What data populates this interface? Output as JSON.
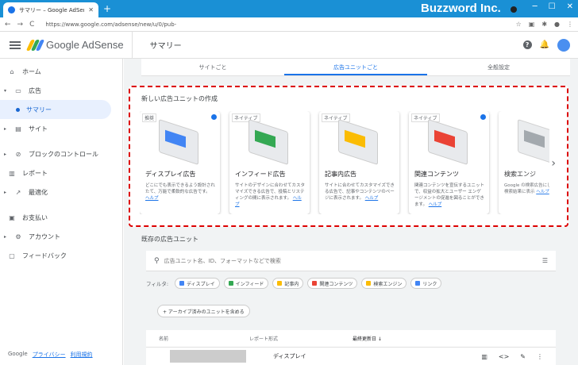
{
  "browser": {
    "tab_title": "サマリー – Google AdSense",
    "tab_close": "✕",
    "new_tab": "+",
    "url": "https://www.google.com/adsense/new/u/0/pub-",
    "nav_back": "←",
    "nav_forward": "→",
    "nav_reload": "C",
    "brand": "Buzzword Inc.",
    "win_min": "─",
    "win_max": "☐",
    "win_close": "✕"
  },
  "app": {
    "logo_text": "Google AdSense",
    "page_title": "サマリー",
    "help_icon": "?",
    "logo_colors": [
      "#fbbc04",
      "#34a853",
      "#4285f4"
    ]
  },
  "sidebar": {
    "items": [
      {
        "label": "ホーム",
        "icon": "home-icon",
        "glyph": "⌂"
      },
      {
        "label": "広告",
        "icon": "ads-icon",
        "glyph": "▭"
      },
      {
        "label": "サマリー",
        "icon": "dot"
      },
      {
        "label": "サイト",
        "icon": "sites-icon",
        "glyph": "▤"
      },
      {
        "label": "ブロックのコントロール",
        "icon": "block-icon",
        "glyph": "⊘"
      },
      {
        "label": "レポート",
        "icon": "report-icon",
        "glyph": "▥"
      },
      {
        "label": "最適化",
        "icon": "optimize-icon",
        "glyph": "↗"
      },
      {
        "label": "お支払い",
        "icon": "payments-icon",
        "glyph": "▣"
      },
      {
        "label": "アカウント",
        "icon": "account-icon",
        "glyph": "⚙"
      },
      {
        "label": "フィードバック",
        "icon": "feedback-icon",
        "glyph": "▢"
      }
    ],
    "footer": {
      "google": "Google",
      "privacy": "プライバシー",
      "terms": "利用規約"
    }
  },
  "tabs": [
    "サイトごと",
    "広告ユニットごと",
    "全般設定"
  ],
  "create": {
    "title": "新しい広告ユニットの作成",
    "cards": [
      {
        "tag": "推奨",
        "name": "ディスプレイ広告",
        "desc": "どこにでも表示できるよう設計されたて、万能で柔軟的な広告です。",
        "help": "ヘルプ",
        "color": "#4285f4",
        "info": true
      },
      {
        "tag": "ネイティブ",
        "name": "インフィード広告",
        "desc": "サイトのデザインに合わせてカスタマイズできる広告で、投稿とリスティングの間に表示されます。",
        "help": "ヘルプ",
        "color": "#34a853",
        "info": false
      },
      {
        "tag": "ネイティブ",
        "name": "記事内広告",
        "desc": "サイトに合わせてカスタマイズできる広告で、記事やコンテンツのページに表示されます。",
        "help": "ヘルプ",
        "color": "#fbbc04",
        "info": false
      },
      {
        "tag": "ネイティブ",
        "name": "関連コンテンツ",
        "desc": "関連コンテンツを宣伝するユニットで、収益の拡大とユーザー エンゲージメントの促進を図ることができます。",
        "help": "ヘルプ",
        "color": "#ea4335",
        "info": true
      },
      {
        "tag": "",
        "name": "検索エンジ",
        "desc": "Google の検索広告にしたもので、検索結果に表示",
        "help": "ヘルプ",
        "color": "#9aa0a6",
        "info": false
      }
    ],
    "next_icon": "›"
  },
  "existing": {
    "title": "既存の広告ユニット",
    "search_placeholder": "広告ユニット名、ID、フォーマットなどで検索",
    "search_icon": "⚲",
    "filter_icon": "☰",
    "filter_label": "フィルタ:",
    "filters": [
      {
        "label": "ディスプレイ",
        "color": "#4285f4"
      },
      {
        "label": "インフィード",
        "color": "#34a853"
      },
      {
        "label": "記事内",
        "color": "#fbbc04"
      },
      {
        "label": "関連コンテンツ",
        "color": "#ea4335"
      },
      {
        "label": "検索エンジン",
        "color": "#fbbc04"
      },
      {
        "label": "リンク",
        "color": "#4285f4"
      }
    ],
    "archive_button": "+ アーカイブ済みのユニットを含める",
    "columns": {
      "name": "名前",
      "format": "レポート形式",
      "updated": "最終更新日 ↓"
    },
    "rows": [
      {
        "format": "ディスプレイ"
      }
    ],
    "row_actions": [
      "▥",
      "<>",
      "✎",
      "⋮"
    ]
  }
}
